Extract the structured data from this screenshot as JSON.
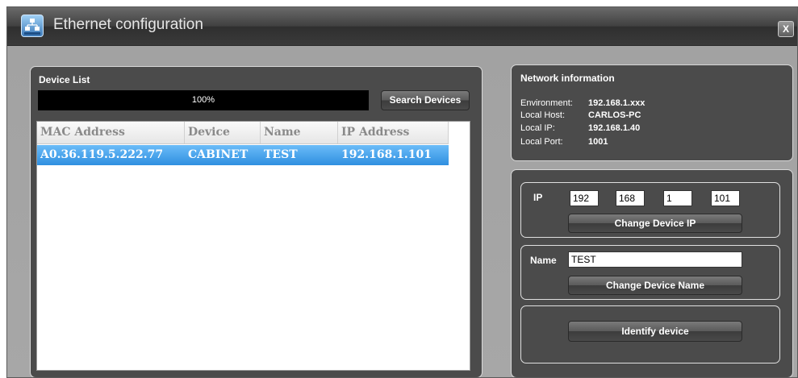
{
  "window": {
    "title": "Ethernet configuration",
    "close_label": "X",
    "icon": "network-icon"
  },
  "device_list": {
    "title": "Device List",
    "progress": "100%",
    "progress_fraction": 1.0,
    "search_button": "Search Devices",
    "columns": [
      "MAC Address",
      "Device",
      "Name",
      "IP Address"
    ],
    "rows": [
      {
        "mac": "A0.36.119.5.222.77",
        "device": "CABINET",
        "name": "TEST",
        "ip": "192.168.1.101",
        "selected": true
      }
    ]
  },
  "network_info": {
    "title": "Network information",
    "items": [
      {
        "label": "Environment:",
        "value": "192.168.1.xxx"
      },
      {
        "label": "Local Host:",
        "value": "CARLOS-PC"
      },
      {
        "label": "Local IP:",
        "value": "192.168.1.40"
      },
      {
        "label": "Local Port:",
        "value": "1001"
      }
    ]
  },
  "ip_section": {
    "label": "IP",
    "octets": [
      "192",
      "168",
      "1",
      "101"
    ],
    "button": "Change Device IP"
  },
  "name_section": {
    "label": "Name",
    "value": "TEST",
    "button": "Change Device Name"
  },
  "identify_section": {
    "button": "Identify device"
  },
  "colors": {
    "selection": "#3b95e3",
    "panel": "#4b4b4b"
  }
}
